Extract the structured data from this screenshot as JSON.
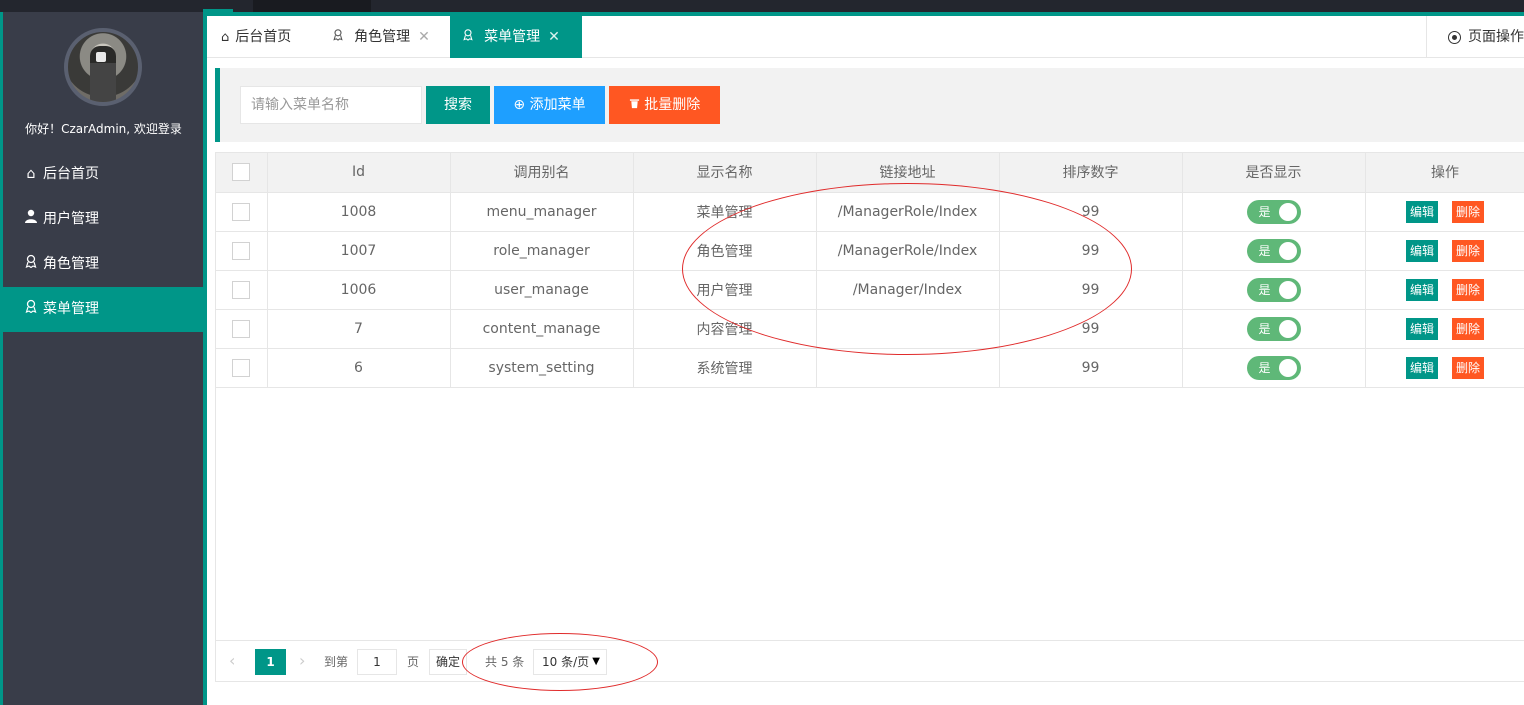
{
  "sidebar": {
    "greeting": "你好！CzarAdmin, 欢迎登录",
    "items": [
      {
        "label": "后台首页",
        "icon": "home-icon"
      },
      {
        "label": "用户管理",
        "icon": "user-icon"
      },
      {
        "label": "角色管理",
        "icon": "role-icon"
      },
      {
        "label": "菜单管理",
        "icon": "menu-icon",
        "active": true
      }
    ]
  },
  "tabs": [
    {
      "label": "后台首页",
      "icon": "home-icon"
    },
    {
      "label": "角色管理",
      "icon": "role-icon",
      "closable": true
    },
    {
      "label": "菜单管理",
      "icon": "menu-icon",
      "closable": true,
      "active": true
    }
  ],
  "page_ops": {
    "label": "页面操作"
  },
  "toolbar": {
    "search_placeholder": "请输入菜单名称",
    "search_label": "搜索",
    "add_label": "添加菜单",
    "batch_delete_label": "批量删除"
  },
  "table": {
    "columns": [
      "Id",
      "调用别名",
      "显示名称",
      "链接地址",
      "排序数字",
      "是否显示",
      "操作"
    ],
    "rows": [
      {
        "id": "1008",
        "alias": "menu_manager",
        "name": "菜单管理",
        "url": "/ManagerRole/Index",
        "sort": "99",
        "show": "是"
      },
      {
        "id": "1007",
        "alias": "role_manager",
        "name": "角色管理",
        "url": "/ManagerRole/Index",
        "sort": "99",
        "show": "是"
      },
      {
        "id": "1006",
        "alias": "user_manage",
        "name": "用户管理",
        "url": "/Manager/Index",
        "sort": "99",
        "show": "是"
      },
      {
        "id": "7",
        "alias": "content_manage",
        "name": "内容管理",
        "url": "",
        "sort": "99",
        "show": "是"
      },
      {
        "id": "6",
        "alias": "system_setting",
        "name": "系统管理",
        "url": "",
        "sort": "99",
        "show": "是"
      }
    ],
    "edit_label": "编辑",
    "delete_label": "删除"
  },
  "pager": {
    "current": "1",
    "goto_label": "到第",
    "goto_value": "1",
    "page_label": "页",
    "ok_label": "确定",
    "total_label": "共 5 条",
    "limit_label": "10 条/页"
  },
  "colors": {
    "primary": "#009688",
    "blue": "#1e9fff",
    "danger": "#ff5722",
    "switch_on": "#5fb878",
    "sidebar_bg": "#393d49"
  }
}
